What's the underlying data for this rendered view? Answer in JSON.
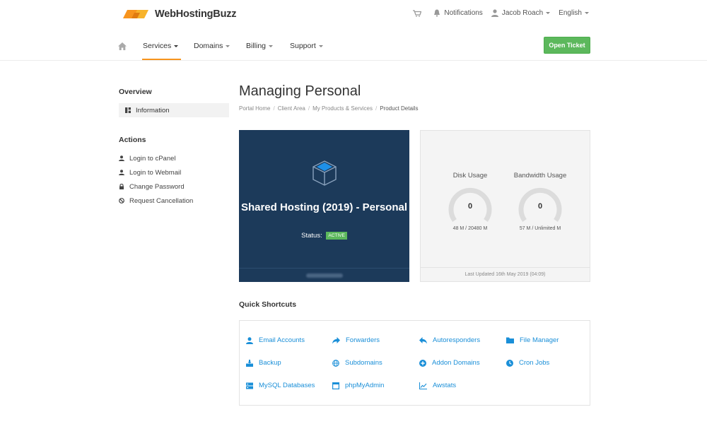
{
  "brand": {
    "name": "WebHostingBuzz",
    "accent": "#f7941d",
    "green": "#5cb85c",
    "dark_card": "#1c3a5a",
    "link": "#1a8fd8"
  },
  "topbar": {
    "cart_icon": "cart-icon",
    "notifications": "Notifications",
    "user": "Jacob Roach",
    "language": "English"
  },
  "nav": {
    "home_icon": "home-icon",
    "items": [
      {
        "label": "Services",
        "active": true
      },
      {
        "label": "Domains"
      },
      {
        "label": "Billing"
      },
      {
        "label": "Support"
      }
    ],
    "open_ticket": "Open Ticket"
  },
  "sidebar": {
    "overview_heading": "Overview",
    "information": "Information",
    "actions_heading": "Actions",
    "actions": [
      {
        "label": "Login to cPanel",
        "icon": "user-icon"
      },
      {
        "label": "Login to Webmail",
        "icon": "user-icon"
      },
      {
        "label": "Change Password",
        "icon": "lock-icon"
      },
      {
        "label": "Request Cancellation",
        "icon": "ban-icon"
      }
    ]
  },
  "main": {
    "title": "Managing Personal",
    "breadcrumb": [
      "Portal Home",
      "Client Area",
      "My Products & Services",
      "Product Details"
    ],
    "product": {
      "name": "Shared Hosting (2019) - Personal",
      "status_label": "Status:",
      "status": "ACTIVE"
    },
    "usage": {
      "disk": {
        "label": "Disk Usage",
        "value": "0",
        "detail": "48 M / 20480 M",
        "percent": 0
      },
      "bandwidth": {
        "label": "Bandwidth Usage",
        "value": "0",
        "detail": "57 M / Unlimited M",
        "percent": 0
      },
      "last_updated": "Last Updated 16th May 2019 (04:09)"
    },
    "shortcuts_title": "Quick Shortcuts",
    "shortcuts": [
      {
        "label": "Email Accounts",
        "icon": "user-icon"
      },
      {
        "label": "Forwarders",
        "icon": "share-arrow-icon"
      },
      {
        "label": "Autoresponders",
        "icon": "reply-icon"
      },
      {
        "label": "File Manager",
        "icon": "folder-icon"
      },
      {
        "label": "Backup",
        "icon": "backup-icon"
      },
      {
        "label": "Subdomains",
        "icon": "globe-icon"
      },
      {
        "label": "Addon Domains",
        "icon": "plus-circle-icon"
      },
      {
        "label": "Cron Jobs",
        "icon": "clock-icon"
      },
      {
        "label": "MySQL Databases",
        "icon": "database-icon"
      },
      {
        "label": "phpMyAdmin",
        "icon": "window-icon"
      },
      {
        "label": "Awstats",
        "icon": "line-chart-icon"
      }
    ]
  }
}
